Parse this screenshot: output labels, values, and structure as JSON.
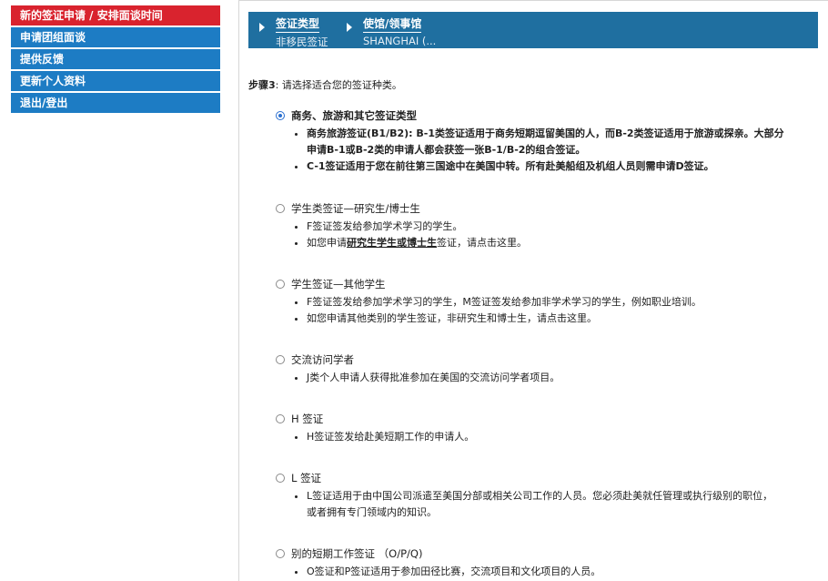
{
  "sidebar": {
    "items": [
      {
        "label": "新的签证申请 / 安排面谈时间",
        "active": true
      },
      {
        "label": "申请团组面谈"
      },
      {
        "label": "提供反馈"
      },
      {
        "label": "更新个人资料"
      },
      {
        "label": "退出/登出"
      }
    ]
  },
  "breadcrumb": [
    {
      "label": "签证类型",
      "value": "非移民签证"
    },
    {
      "label": "使馆/领事馆",
      "value": "SHANGHAI (..."
    }
  ],
  "step": {
    "number": "步骤3",
    "text": ": 请选择适合您的签证种类。"
  },
  "options": [
    {
      "title": "商务、旅游和其它签证类型",
      "checked": true,
      "bullets": [
        "商务旅游签证(B1/B2): B-1类签证适用于商务短期逗留美国的人，而B-2类签证适用于旅游或探亲。大部分申请B-1或B-2类的申请人都会获签一张B-1/B-2的组合签证。",
        "C-1签证适用于您在前往第三国途中在美国中转。所有赴美船组及机组人员则需申请D签证。"
      ]
    },
    {
      "title": "学生类签证—研究生/博士生",
      "bullets": [
        "F签证签发给参加学术学习的学生。"
      ],
      "link_bullet": {
        "pre": "如您申请",
        "link": "研究生学生或博士生",
        "post": "签证，请点击这里。"
      }
    },
    {
      "title": "学生签证—其他学生",
      "bullets": [
        "F签证签发给参加学术学习的学生，M签证签发给参加非学术学习的学生，例如职业培训。",
        "如您申请其他类别的学生签证，非研究生和博士生，请点击这里。"
      ]
    },
    {
      "title": "交流访问学者",
      "bullets": [
        "J类个人申请人获得批准参加在美国的交流访问学者项目。"
      ]
    },
    {
      "title": "H 签证",
      "bullets": [
        "H签证签发给赴美短期工作的申请人。"
      ]
    },
    {
      "title": "L 签证",
      "bullets": [
        "L签证适用于由中国公司派遣至美国分部或相关公司工作的人员。您必须赴美就任管理或执行级别的职位，或者拥有专门领域内的知识。"
      ]
    },
    {
      "title": "别的短期工作签证 （O/P/Q)",
      "bullets": [
        "O签证和P签证适用于参加田径比赛，交流项目和文化项目的人员。"
      ]
    }
  ]
}
